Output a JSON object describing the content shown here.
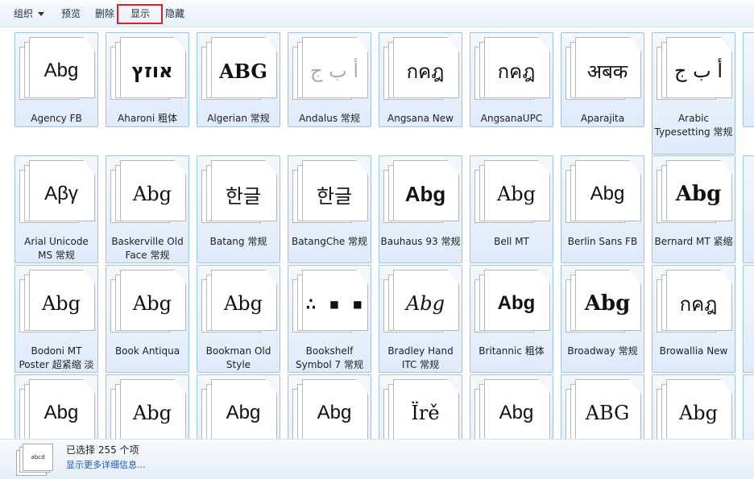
{
  "toolbar": {
    "organize_label": "组织",
    "preview_label": "预览",
    "delete_label": "删除",
    "show_label": "显示",
    "hide_label": "隐藏"
  },
  "fonts": [
    {
      "name": "Agency FB",
      "sample": "Abg",
      "style": "s-sans",
      "faded": false
    },
    {
      "name": "Aharoni 粗体",
      "sample": "אוזץ",
      "style": "s-bold",
      "faded": false
    },
    {
      "name": "Algerian 常规",
      "sample": "ABG",
      "style": "s-serif s-bold",
      "faded": false
    },
    {
      "name": "Andalus 常规",
      "sample": "أ ب ج",
      "style": "s-serif",
      "faded": true
    },
    {
      "name": "Angsana New",
      "sample": "กคฎ",
      "style": "s-serif",
      "faded": false
    },
    {
      "name": "AngsanaUPC",
      "sample": "กคฎ",
      "style": "s-serif",
      "faded": false
    },
    {
      "name": "Aparajita",
      "sample": "अबक",
      "style": "s-serif",
      "faded": false
    },
    {
      "name": "Arabic Typesetting 常规",
      "sample": "أ ب ج",
      "style": "s-serif",
      "faded": false
    },
    {
      "name": "Arial Unicode MS 常规",
      "sample": "Αβγ",
      "style": "s-sans",
      "faded": false
    },
    {
      "name": "Baskerville Old Face 常规",
      "sample": "Abg",
      "style": "s-serif",
      "faded": false
    },
    {
      "name": "Batang 常规",
      "sample": "한글",
      "style": "s-serif",
      "faded": false
    },
    {
      "name": "BatangChe 常规",
      "sample": "한글",
      "style": "s-serif",
      "faded": false
    },
    {
      "name": "Bauhaus 93 常规",
      "sample": "Abg",
      "style": "s-sans s-black",
      "faded": false
    },
    {
      "name": "Bell MT",
      "sample": "Abg",
      "style": "s-serif",
      "faded": false
    },
    {
      "name": "Berlin Sans FB",
      "sample": "Abg",
      "style": "s-sans",
      "faded": false
    },
    {
      "name": "Bernard MT 紧缩",
      "sample": "Abg",
      "style": "s-serif s-black",
      "faded": false
    },
    {
      "name": "Bodoni MT Poster 超紧缩 淡",
      "sample": "Abg",
      "style": "s-serif",
      "faded": false
    },
    {
      "name": "Book Antiqua",
      "sample": "Abg",
      "style": "s-serif",
      "faded": false
    },
    {
      "name": "Bookman Old Style",
      "sample": "Abg",
      "style": "s-serif",
      "faded": false
    },
    {
      "name": "Bookshelf Symbol 7 常规",
      "sample": "∴ ▪ ▪",
      "style": "s-mono",
      "faded": false
    },
    {
      "name": "Bradley Hand ITC 常规",
      "sample": "Abg",
      "style": "s-serif s-italic",
      "faded": false
    },
    {
      "name": "Britannic 粗体",
      "sample": "Abg",
      "style": "s-sans s-bold",
      "faded": false
    },
    {
      "name": "Broadway 常规",
      "sample": "Abg",
      "style": "s-serif s-black",
      "faded": false
    },
    {
      "name": "Browallia New",
      "sample": "กคฎ",
      "style": "s-sans",
      "faded": false
    },
    {
      "name": "",
      "sample": "Abg",
      "style": "s-sans",
      "faded": false
    },
    {
      "name": "",
      "sample": "Abg",
      "style": "s-serif",
      "faded": false
    },
    {
      "name": "",
      "sample": "Abg",
      "style": "s-sans",
      "faded": false
    },
    {
      "name": "",
      "sample": "Abg",
      "style": "s-sans",
      "faded": false
    },
    {
      "name": "",
      "sample": "Ïrě",
      "style": "s-serif",
      "faded": false
    },
    {
      "name": "",
      "sample": "Abg",
      "style": "s-sans",
      "faded": false
    },
    {
      "name": "",
      "sample": "ABG",
      "style": "s-serif",
      "faded": false
    },
    {
      "name": "",
      "sample": "Abg",
      "style": "s-serif",
      "faded": false
    }
  ],
  "status": {
    "selected_text": "已选择 255 个项",
    "details_link": "显示更多详细信息...",
    "thumb_sample": "abcd"
  }
}
